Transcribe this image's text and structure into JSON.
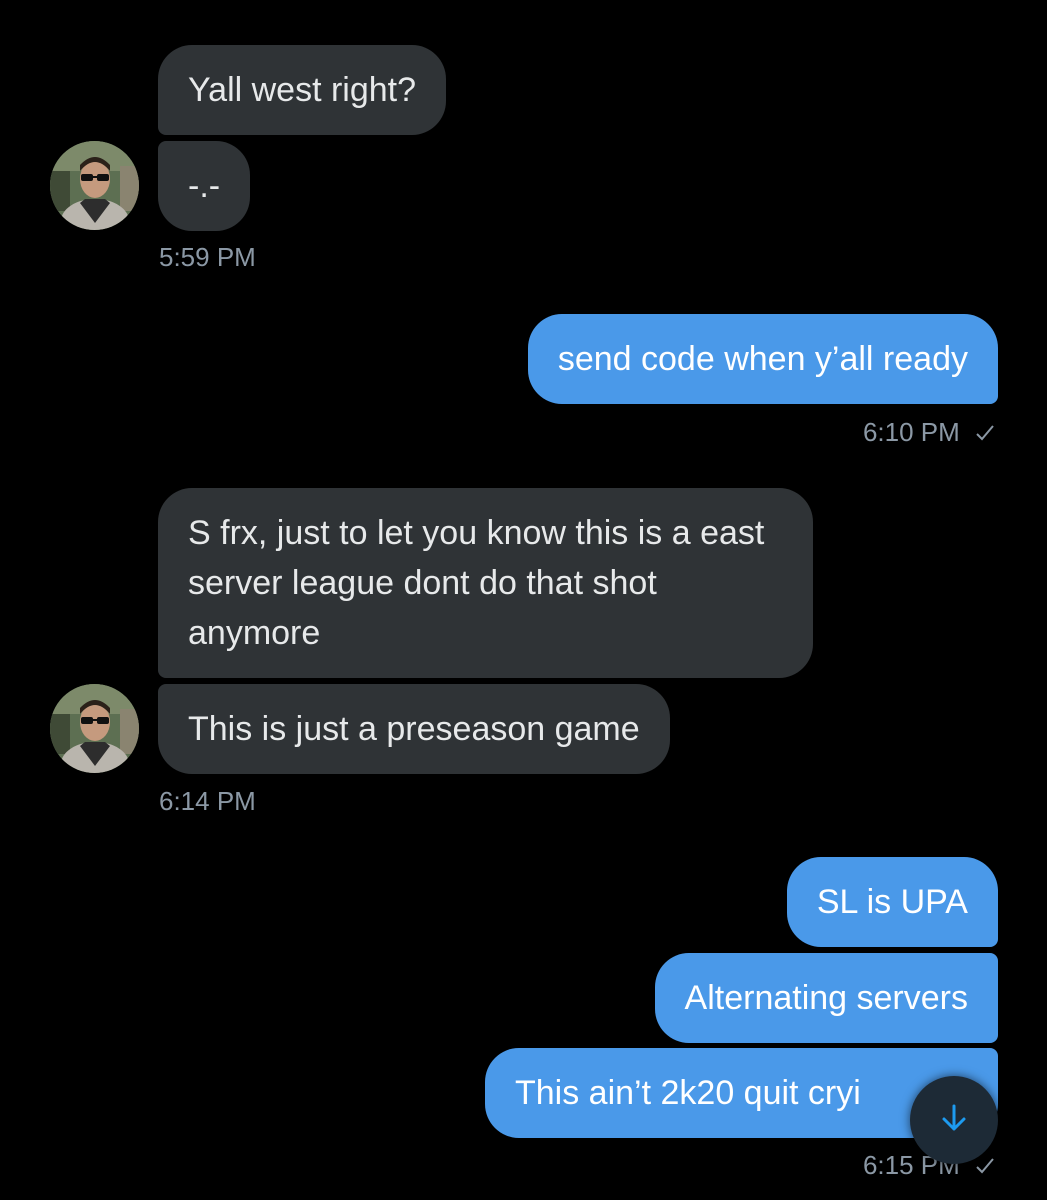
{
  "conversation": {
    "messages": [
      {
        "text": "Yall west right?"
      },
      {
        "text": "-.-"
      },
      {
        "text": "send code when y’all ready"
      },
      {
        "text": "S frx, just to let you know this is a east server league dont do that shot anymore"
      },
      {
        "text": "This is just a preseason game"
      },
      {
        "text": "SL is UPA"
      },
      {
        "text": "Alternating servers"
      },
      {
        "text": "This ain’t 2k20 quit cryi"
      }
    ],
    "timestamps": [
      "5:59 PM",
      "6:10 PM",
      "6:14 PM",
      "6:15 PM"
    ]
  },
  "icons": {
    "avatar": "user-avatar-photo",
    "sent": "checkmark-icon",
    "scroll": "arrow-down-icon"
  },
  "colors": {
    "background": "#000000",
    "incoming_bubble": "#2f3336",
    "outgoing_bubble": "#4a99e9",
    "timestamp": "#8b98a5",
    "accent": "#1d9bf0"
  }
}
